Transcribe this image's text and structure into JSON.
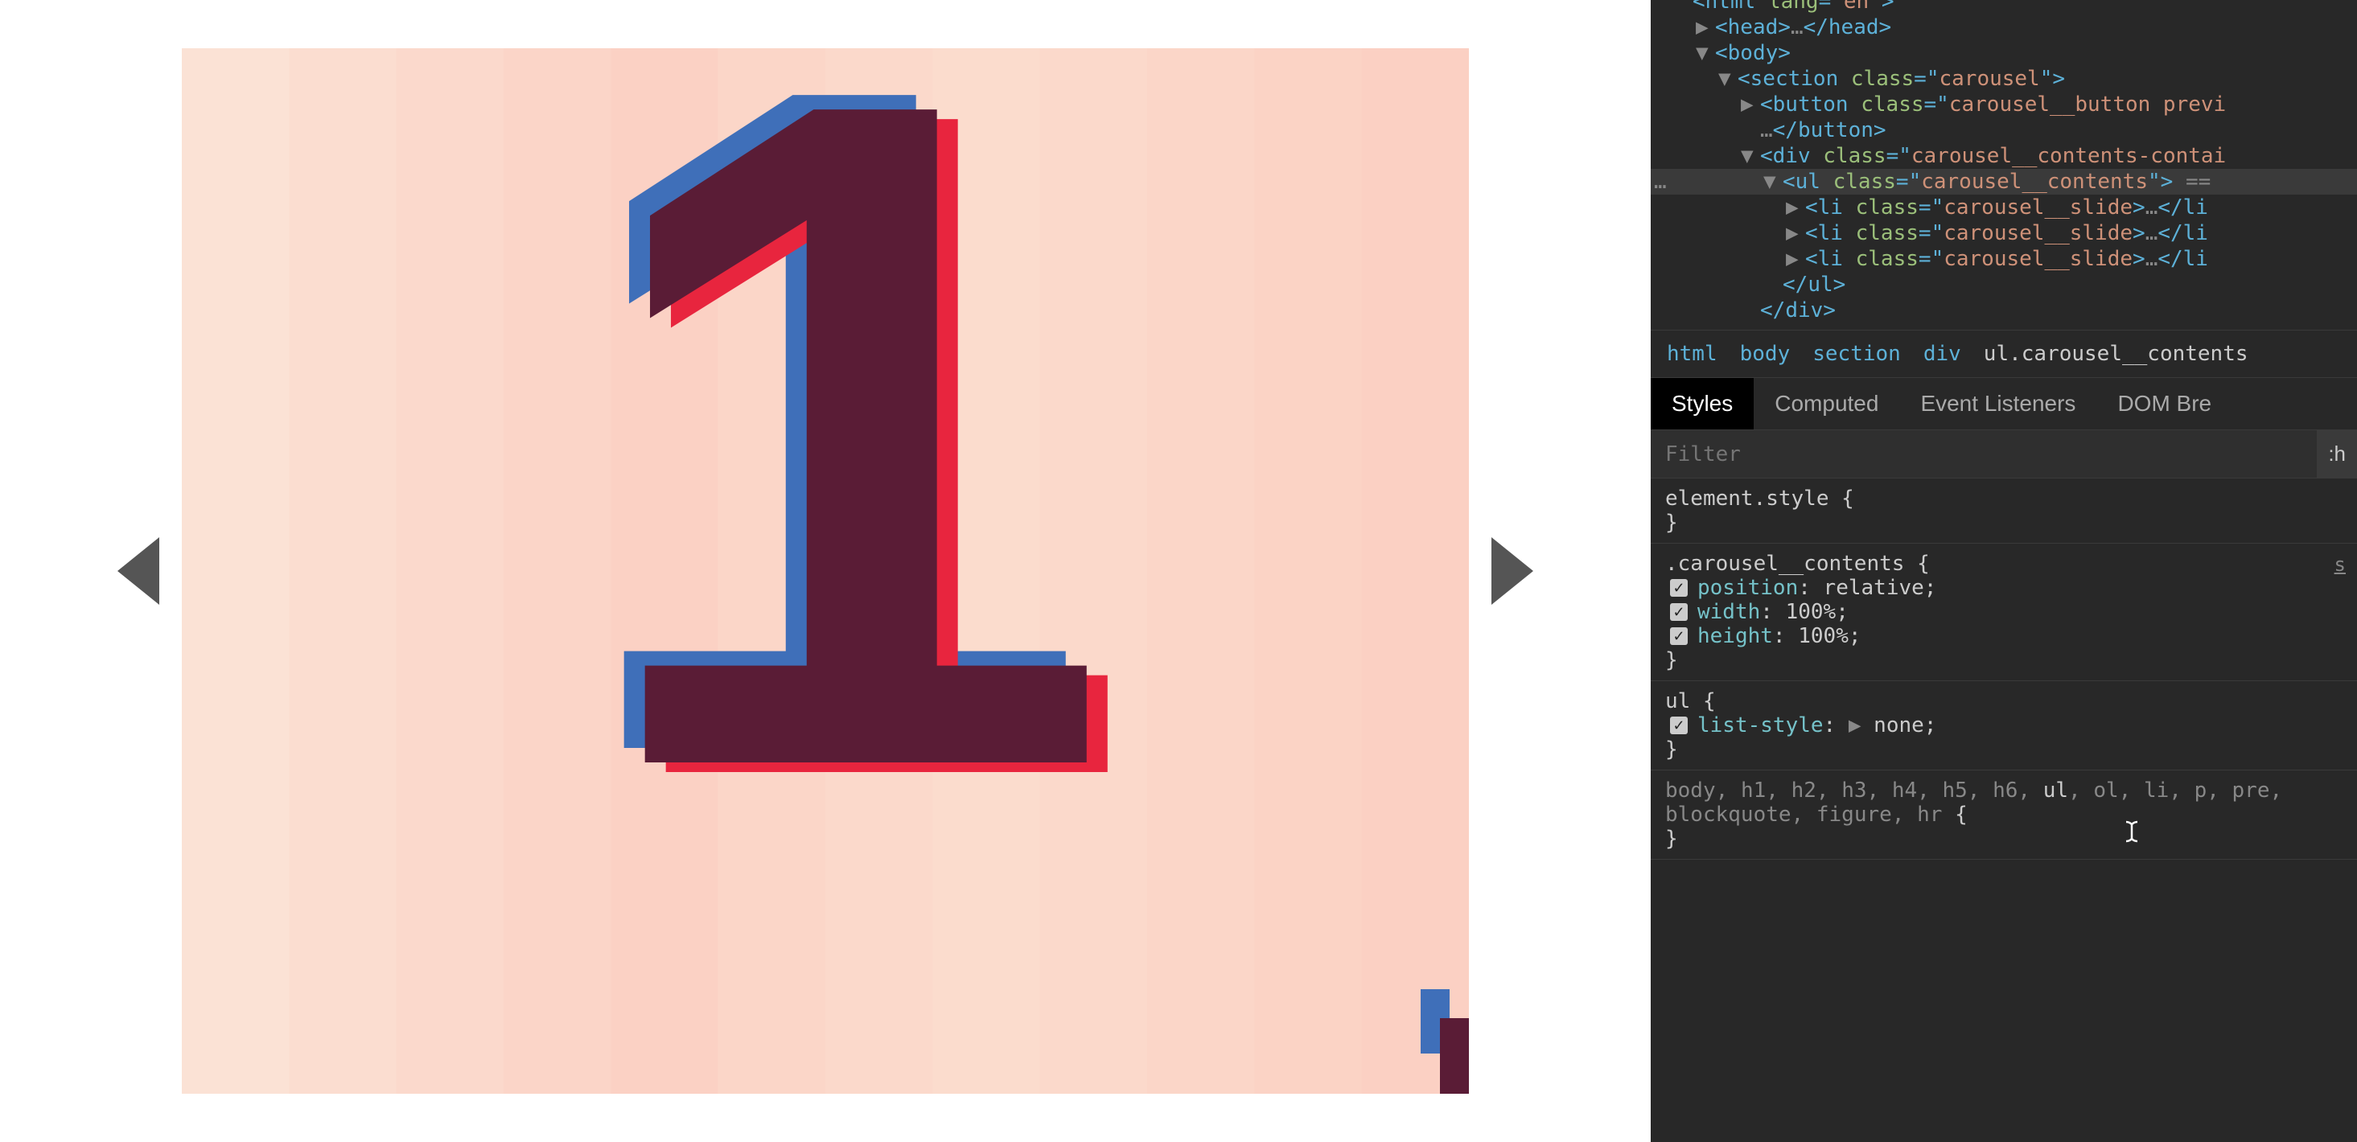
{
  "preview": {
    "slide_digit": "1"
  },
  "dom": {
    "lines": [
      {
        "indent": 0,
        "arrow": "",
        "pre": "<",
        "tag": "html",
        "attrs": [
          [
            "lang",
            "en"
          ]
        ],
        "post": ">",
        "closed": false,
        "cut": true
      },
      {
        "indent": 1,
        "arrow": "▶",
        "pre": "<",
        "tag": "head",
        "post": ">",
        "etc": "…",
        "close_inline": "head"
      },
      {
        "indent": 1,
        "arrow": "▼",
        "pre": "<",
        "tag": "body",
        "post": ">"
      },
      {
        "indent": 2,
        "arrow": "▼",
        "pre": "<",
        "tag": "section",
        "attrs": [
          [
            "class",
            "carousel"
          ]
        ],
        "post": ">"
      },
      {
        "indent": 3,
        "arrow": "▶",
        "pre": "<",
        "tag": "button",
        "attrs": [
          [
            "class",
            "carousel__button previ"
          ]
        ],
        "post": "",
        "cut_right": true
      },
      {
        "indent": 3,
        "arrow": "",
        "etc_line": "…",
        "close_inline": "button"
      },
      {
        "indent": 3,
        "arrow": "▼",
        "pre": "<",
        "tag": "div",
        "attrs": [
          [
            "class",
            "carousel__contents-contai"
          ]
        ],
        "post": "",
        "cut_right": true
      },
      {
        "indent": 4,
        "arrow": "▼",
        "pre": "<",
        "tag": "ul",
        "attrs": [
          [
            "class",
            "carousel__contents"
          ]
        ],
        "post": ">",
        "selected": true,
        "eq": " =="
      },
      {
        "indent": 5,
        "arrow": "▶",
        "pre": "<",
        "tag": "li",
        "attrs": [
          [
            "class",
            "carousel__slide"
          ]
        ],
        "post": ">",
        "etc": "…",
        "close_inline": "li",
        "cut_right": true
      },
      {
        "indent": 5,
        "arrow": "▶",
        "pre": "<",
        "tag": "li",
        "attrs": [
          [
            "class",
            "carousel__slide"
          ]
        ],
        "post": ">",
        "etc": "…",
        "close_inline": "li",
        "cut_right": true
      },
      {
        "indent": 5,
        "arrow": "▶",
        "pre": "<",
        "tag": "li",
        "attrs": [
          [
            "class",
            "carousel__slide"
          ]
        ],
        "post": ">",
        "etc": "…",
        "close_inline": "li",
        "cut_right": true
      },
      {
        "indent": 4,
        "arrow": "",
        "close_tag": "ul"
      },
      {
        "indent": 3,
        "arrow": "",
        "close_tag": "div"
      }
    ]
  },
  "breadcrumb": [
    "html",
    "body",
    "section",
    "div",
    "ul.carousel__contents"
  ],
  "tabs": [
    "Styles",
    "Computed",
    "Event Listeners",
    "DOM Bre"
  ],
  "active_tab": 0,
  "filter_placeholder": "Filter",
  "hov_label": ":h",
  "styles": {
    "rules": [
      {
        "selector": "element.style",
        "props": []
      },
      {
        "selector": ".carousel__contents",
        "source": "s",
        "props": [
          {
            "name": "position",
            "value": "relative"
          },
          {
            "name": "width",
            "value": "100%"
          },
          {
            "name": "height",
            "value": "100%"
          }
        ]
      },
      {
        "selector": "ul",
        "props": [
          {
            "name": "list-style",
            "value": "none",
            "expandable": true
          }
        ]
      },
      {
        "selector_inherit": [
          "body",
          "h1",
          "h2",
          "h3",
          "h4",
          "h5",
          "h6",
          "ul",
          "ol",
          "li",
          "p",
          "pre",
          "blockquote",
          "figure",
          "hr"
        ],
        "inherit_highlight": "ul",
        "props": []
      }
    ]
  }
}
